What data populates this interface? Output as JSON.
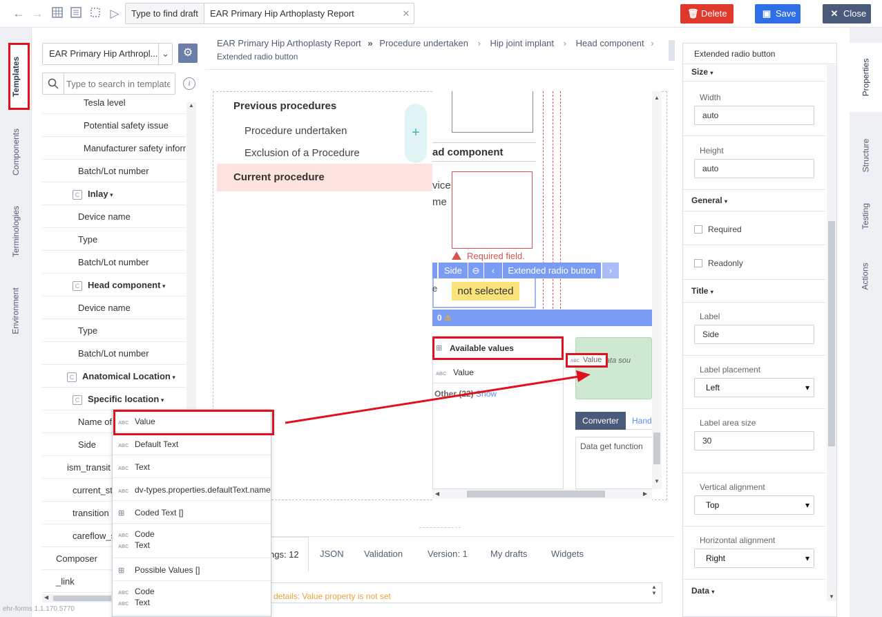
{
  "toolbar": {
    "search_placeholder": "Type to find draft",
    "current_draft": "EAR Primary Hip Arthoplasty Report",
    "delete_label": "Delete",
    "save_label": "Save",
    "close_label": "Close"
  },
  "left_tabs": [
    "Templates",
    "Components",
    "Terminologies",
    "Environment"
  ],
  "template_select": "EAR Primary Hip Arthropl...",
  "template_search_placeholder": "Type to search in template",
  "tree": [
    {
      "label": "Tesla level",
      "indent": 60
    },
    {
      "label": "Potential safety issue",
      "indent": 60
    },
    {
      "label": "Manufacturer safety inform",
      "indent": 60
    },
    {
      "label": "Batch/Lot number",
      "indent": 52
    },
    {
      "label": "Inlay",
      "indent": 44,
      "container": true
    },
    {
      "label": "Device name",
      "indent": 52
    },
    {
      "label": "Type",
      "indent": 52
    },
    {
      "label": "Batch/Lot number",
      "indent": 52
    },
    {
      "label": "Head component",
      "indent": 44,
      "container": true
    },
    {
      "label": "Device name",
      "indent": 52
    },
    {
      "label": "Type",
      "indent": 52
    },
    {
      "label": "Batch/Lot number",
      "indent": 52
    },
    {
      "label": "Anatomical Location",
      "indent": 36,
      "container": true
    },
    {
      "label": "Specific location",
      "indent": 44,
      "container": true
    },
    {
      "label": "Name of",
      "indent": 52
    },
    {
      "label": "Side",
      "indent": 52
    },
    {
      "label": "ism_transit",
      "indent": 36
    },
    {
      "label": "current_st",
      "indent": 44
    },
    {
      "label": "transition",
      "indent": 44
    },
    {
      "label": "careflow_s",
      "indent": 44
    },
    {
      "label": "Composer",
      "indent": 20
    },
    {
      "label": "_link",
      "indent": 20
    }
  ],
  "version": "ehr-forms 1.1.170.5770",
  "breadcrumb": [
    "EAR Primary Hip Arthoplasty Report",
    "Procedure undertaken",
    "Hip joint implant",
    "Head component",
    "Extended radio button"
  ],
  "nav_menu": {
    "heading": "Previous procedures",
    "items": [
      "Procedure undertaken",
      "Exclusion of a Procedure"
    ],
    "current": "Current procedure"
  },
  "canvas": {
    "head_component": "ad component",
    "vice": "vice",
    "me": "me",
    "required_field": "Required field.",
    "toolbar_side": "Side",
    "toolbar_ext": "Extended radio button",
    "e": "e",
    "not_selected": "not selected",
    "status_count": "0",
    "available_values": "Available values",
    "value": "Value",
    "other": "Other (22)",
    "show": "Show",
    "drop_value": "Value",
    "drop_hint": "ove data sou",
    "converter": "Converter",
    "handler": "Hand",
    "data_get_function": "Data get function"
  },
  "bottom_tabs": [
    "ngs: 12",
    "JSON",
    "Validation",
    "Version: 1",
    "My drafts",
    "Widgets"
  ],
  "bottom_message": "details: Value property is not set",
  "dropdown": [
    {
      "lines": [
        "Value"
      ],
      "type": "abc"
    },
    {
      "lines": [
        "Default Text"
      ],
      "type": "abc"
    },
    {
      "lines": [
        "Text"
      ],
      "type": "abc"
    },
    {
      "lines": [
        "dv-types.properties.defaultText.name"
      ],
      "type": "abc"
    },
    {
      "lines": [
        "Coded Text  []"
      ],
      "type": "tree"
    },
    {
      "lines": [
        "Code",
        "Text"
      ],
      "type": "abc"
    },
    {
      "lines": [
        "Possible Values  []"
      ],
      "type": "tree"
    },
    {
      "lines": [
        "Code",
        "Text"
      ],
      "type": "abc"
    }
  ],
  "properties": {
    "title": "Extended radio button",
    "size": "Size",
    "width_label": "Width",
    "width_value": "auto",
    "height_label": "Height",
    "height_value": "auto",
    "general": "General",
    "required": "Required",
    "readonly": "Readonly",
    "title_section": "Title",
    "label_label": "Label",
    "label_value": "Side",
    "label_placement_label": "Label placement",
    "label_placement_value": "Left",
    "label_area_label": "Label area size",
    "label_area_value": "30",
    "valign_label": "Vertical alignment",
    "valign_value": "Top",
    "halign_label": "Horizontal alignment",
    "halign_value": "Right",
    "data": "Data"
  },
  "right_tabs": [
    "Properties",
    "Structure",
    "Testing",
    "Actions"
  ],
  "colors": {
    "delete": "#e0392b",
    "save": "#2e6fe8",
    "close": "#4a5a7a",
    "accent": "#7b9cf5",
    "danger": "#e0101f"
  }
}
